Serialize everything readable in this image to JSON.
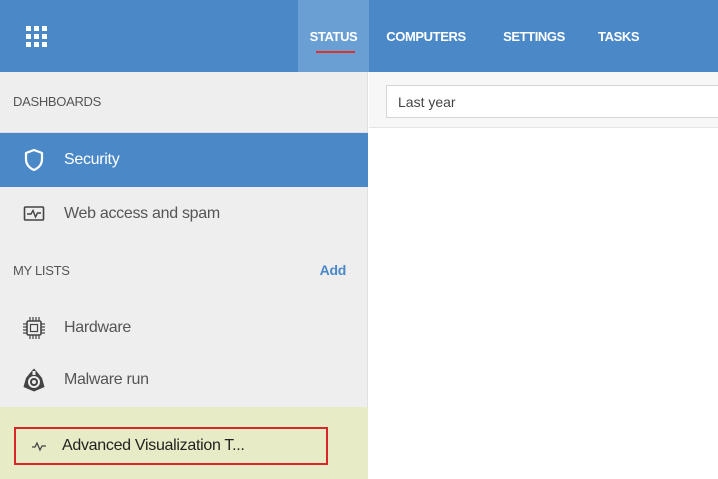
{
  "topbar": {
    "apps_icon": "grid-icon",
    "tabs": [
      {
        "label": "STATUS",
        "active": true
      },
      {
        "label": "COMPUTERS",
        "active": false
      },
      {
        "label": "SETTINGS",
        "active": false
      },
      {
        "label": "TASKS",
        "active": false
      }
    ]
  },
  "sidebar": {
    "dashboards_header": "DASHBOARDS",
    "dashboards": [
      {
        "label": "Security",
        "icon": "shield-icon",
        "active": true
      },
      {
        "label": "Web access and spam",
        "icon": "activity-monitor-icon",
        "active": false
      }
    ],
    "lists_header": "MY LISTS",
    "add_label": "Add",
    "lists": [
      {
        "label": "Hardware",
        "icon": "chip-icon"
      },
      {
        "label": "Malware run",
        "icon": "malware-icon"
      }
    ],
    "advanced": {
      "label": "Advanced Visualization T...",
      "icon": "pulse-icon"
    }
  },
  "filter": {
    "value": "Last year"
  },
  "colors": {
    "topbar": "#4a88c8",
    "active_tab": "#6a9fd4",
    "active_item": "#4a88c8",
    "tab_underline": "#e0302a",
    "highlight_row": "#e8ecc6",
    "highlight_border": "#d9262b"
  }
}
